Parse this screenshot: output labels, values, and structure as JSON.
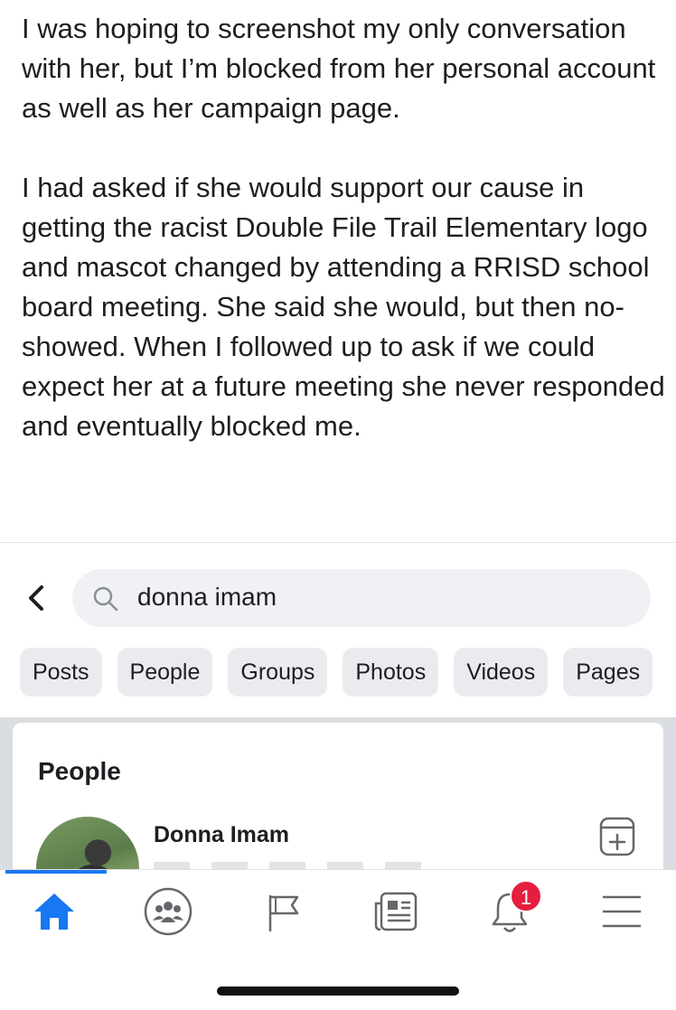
{
  "post": {
    "paragraph_1": "I was hoping to screenshot my only conversation with her, but I’m blocked from her personal account as well as her campaign page.",
    "paragraph_2": "I had asked if she would support our cause in getting the racist Double File Trail Elementary logo and mascot changed by attending a RRISD school board meeting. She said she would, but then no-showed. When I followed up to ask if we could expect her at a future meeting she never responded and eventually blocked me."
  },
  "search": {
    "query": "donna imam",
    "back_icon": "chevron-left-icon",
    "search_icon": "magnifier-icon"
  },
  "filters": [
    "Posts",
    "People",
    "Groups",
    "Photos",
    "Videos",
    "Pages"
  ],
  "results": {
    "section_title": "People",
    "items": [
      {
        "name": "Donna Imam",
        "action_icon": "add-friend-icon"
      }
    ]
  },
  "tab_bar": {
    "items": [
      {
        "icon": "home-icon",
        "active": true
      },
      {
        "icon": "groups-icon",
        "active": false
      },
      {
        "icon": "pages-flag-icon",
        "active": false
      },
      {
        "icon": "news-feed-icon",
        "active": false
      },
      {
        "icon": "notifications-bell-icon",
        "active": false,
        "badge": "1"
      },
      {
        "icon": "menu-icon",
        "active": false
      }
    ]
  },
  "colors": {
    "accent": "#1877f2",
    "badge": "#e41e3f",
    "chip_bg": "#e9ebee",
    "search_bg": "#eff1f4",
    "icon_gray": "#65676b"
  }
}
